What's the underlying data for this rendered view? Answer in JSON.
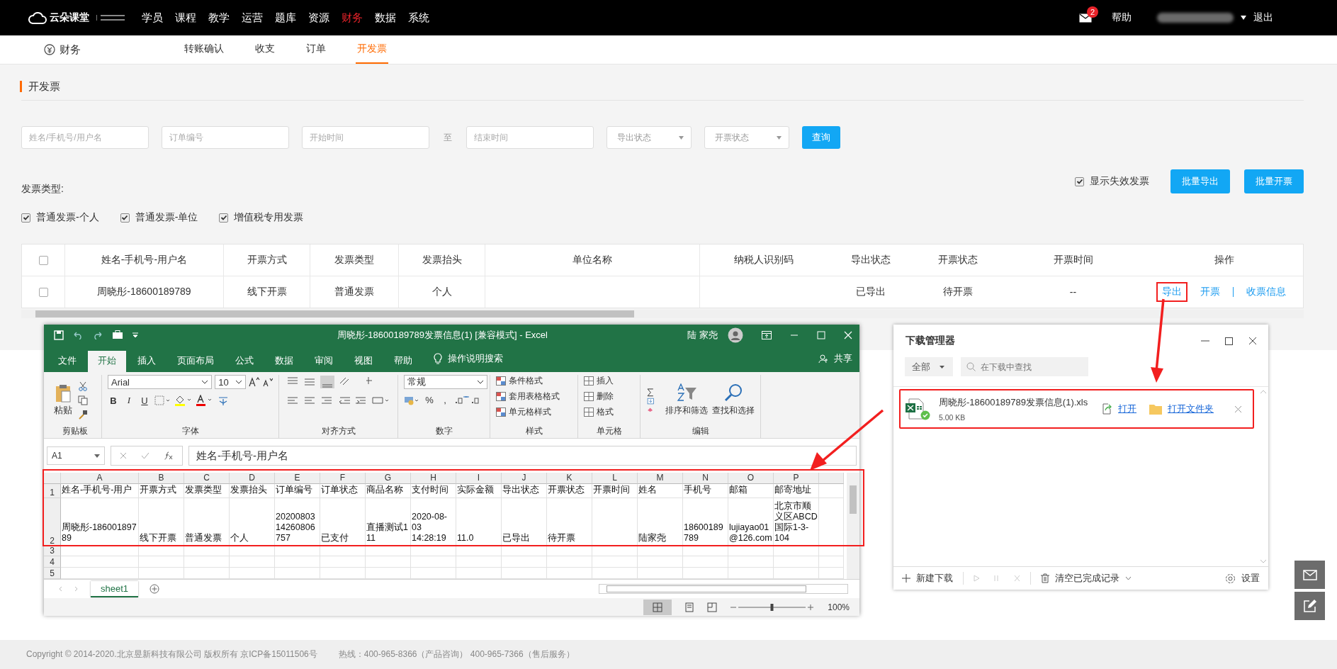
{
  "topbar": {
    "logo": "云朵课堂",
    "nav": [
      {
        "label": "学员",
        "selected": false
      },
      {
        "label": "课程",
        "selected": false
      },
      {
        "label": "教学",
        "selected": false
      },
      {
        "label": "运营",
        "selected": false
      },
      {
        "label": "题库",
        "selected": false
      },
      {
        "label": "资源",
        "selected": false
      },
      {
        "label": "财务",
        "selected": true
      },
      {
        "label": "数据",
        "selected": false
      },
      {
        "label": "系统",
        "selected": false
      }
    ],
    "mail_badge": "2",
    "help": "帮助",
    "logout": "退出"
  },
  "subnav": {
    "title": "财务",
    "tabs": [
      {
        "label": "转账确认",
        "selected": false
      },
      {
        "label": "收支",
        "selected": false
      },
      {
        "label": "订单",
        "selected": false
      },
      {
        "label": "开发票",
        "selected": true
      }
    ]
  },
  "section_title": "开发票",
  "filters": {
    "fields": [
      {
        "placeholder": "姓名/手机号/用户名"
      },
      {
        "placeholder": "订单编号"
      },
      {
        "placeholder": "开始时间"
      },
      {
        "placeholder": "结束时间"
      }
    ],
    "range_separator": "至",
    "selects": [
      {
        "placeholder": "导出状态"
      },
      {
        "placeholder": "开票状态"
      }
    ],
    "query_button": "查询"
  },
  "invoice_type": {
    "label": "发票类型:",
    "options": [
      {
        "label": "普通发票-个人",
        "checked": true
      },
      {
        "label": "普通发票-单位",
        "checked": true
      },
      {
        "label": "增值税专用发票",
        "checked": true
      }
    ]
  },
  "show_invalid": {
    "label": "显示失效发票",
    "checked": true
  },
  "batch_buttons": [
    "批量导出",
    "批量开票"
  ],
  "table": {
    "header_checked": false,
    "columns": [
      "姓名-手机号-用户名",
      "开票方式",
      "发票类型",
      "发票抬头",
      "单位名称",
      "纳税人识别码",
      "导出状态",
      "开票状态",
      "开票时间",
      "操作"
    ],
    "rows": [
      {
        "checked": false,
        "cells": [
          "周晓彤-18600189789",
          "线下开票",
          "普通发票",
          "个人",
          null,
          null,
          "已导出",
          "待开票",
          "--"
        ],
        "actions": [
          {
            "label": "导出",
            "highlighted": true
          },
          {
            "label": "开票",
            "highlighted": false
          },
          {
            "label": "收票信息",
            "highlighted": false
          }
        ]
      }
    ]
  },
  "excel": {
    "title": "周晓彤-18600189789发票信息(1)  [兼容模式]  -  Excel",
    "user": "陆 家尧",
    "tabs": [
      {
        "label": "文件",
        "selected": false
      },
      {
        "label": "开始",
        "selected": true
      },
      {
        "label": "插入",
        "selected": false
      },
      {
        "label": "页面布局",
        "selected": false
      },
      {
        "label": "公式",
        "selected": false
      },
      {
        "label": "数据",
        "selected": false
      },
      {
        "label": "审阅",
        "selected": false
      },
      {
        "label": "视图",
        "selected": false
      },
      {
        "label": "帮助",
        "selected": false
      }
    ],
    "tell_me": "操作说明搜索",
    "share": "共享",
    "ribbon": {
      "paste": "粘贴",
      "font_name": "Arial",
      "font_size": "10",
      "font_styles": [
        "B",
        "I",
        "U"
      ],
      "number_format": "常规",
      "number_symbols": [
        "%",
        ","
      ],
      "styles": [
        "条件格式",
        "套用表格格式",
        "单元格样式"
      ],
      "cells": [
        "插入",
        "删除",
        "格式"
      ],
      "editing": [
        "排序和筛选",
        "查找和选择"
      ],
      "groups": [
        "剪贴板",
        "字体",
        "对齐方式",
        "数字",
        "样式",
        "单元格",
        "编辑"
      ]
    },
    "name_box": "A1",
    "formula": "姓名-手机号-用户名",
    "columns": [
      "A",
      "B",
      "C",
      "D",
      "E",
      "F",
      "G",
      "H",
      "I",
      "J",
      "K",
      "L",
      "M",
      "N",
      "O",
      "P"
    ],
    "rows": [
      {
        "number": "1",
        "cells": [
          "姓名-手机号-用户",
          "开票方式",
          "发票类型",
          "发票抬头",
          "订单编号",
          "订单状态",
          "商品名称",
          "支付时间",
          "实际金额",
          "导出状态",
          "开票状态",
          "开票时间",
          "姓名",
          "手机号",
          "邮箱",
          "邮寄地址"
        ]
      },
      {
        "number": "2",
        "cells": [
          "周晓彤-18600189789",
          "线下开票",
          "普通发票",
          "个人",
          "2020080314260806757",
          "已支付",
          "直播测试111",
          "2020-08-03 14:28:19",
          "11.0",
          "已导出",
          "待开票",
          null,
          "陆家尧",
          "18600189789",
          "lujiayao01@126.com",
          "北京市顺义区ABCD国际1-3-104"
        ]
      },
      {
        "number": "3"
      },
      {
        "number": "4"
      },
      {
        "number": "5"
      }
    ],
    "highlighted": true,
    "zoom_slider": {
      "level": 0.5
    },
    "sheets": [
      {
        "label": "sheet1",
        "selected": true
      }
    ],
    "zoom": "100%"
  },
  "download_manager": {
    "title": "下载管理器",
    "filter": "全部",
    "search": {
      "placeholder": "在下载中查找"
    },
    "items": [
      {
        "filename": "周晓彤-18600189789发票信息(1).xls",
        "size": "5.00 KB",
        "actions": [
          "打开",
          "打开文件夹"
        ],
        "highlighted": true
      }
    ],
    "new_download": "新建下载",
    "clear": "清空已完成记录",
    "settings": "设置"
  },
  "footer": {
    "copyright": "Copyright © 2014-2020.北京昱新科技有限公司 版权所有 京ICP备15011506号",
    "hotline": "热线：400-965-8366（产品咨询） 400-965-7366（售后服务）"
  }
}
